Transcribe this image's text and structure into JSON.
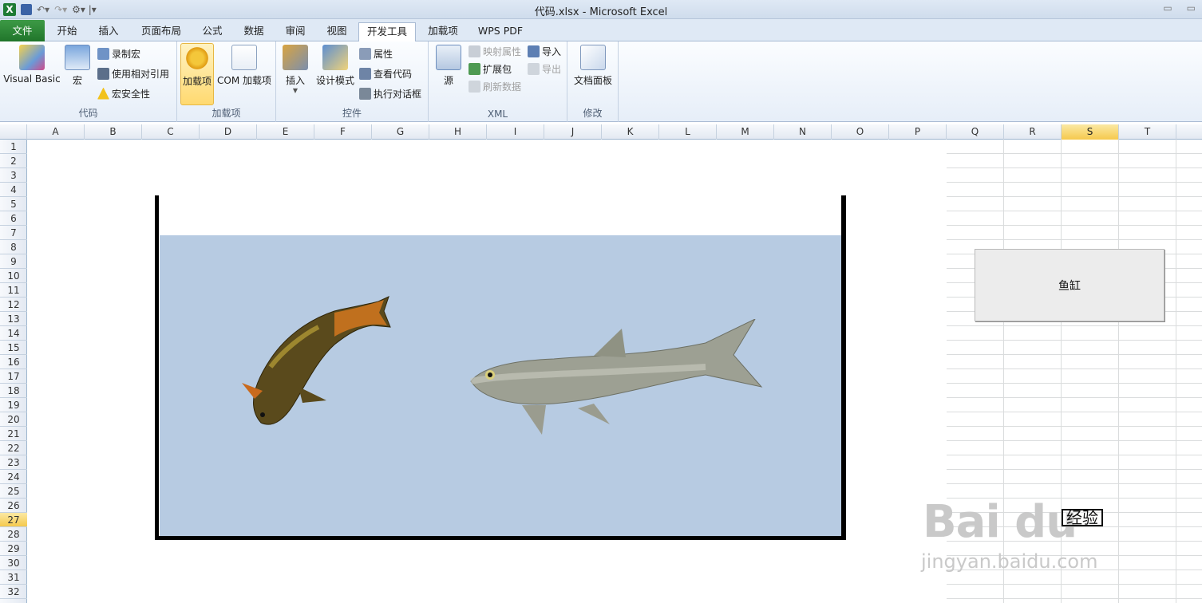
{
  "window": {
    "title": "代码.xlsx  -  Microsoft Excel",
    "excel_icon": "X"
  },
  "qat": {
    "icons": [
      "save-icon",
      "undo-icon",
      "redo-icon",
      "customize-icon"
    ]
  },
  "tabs": {
    "file": "文件",
    "items": [
      "开始",
      "插入",
      "页面布局",
      "公式",
      "数据",
      "审阅",
      "视图",
      "开发工具",
      "加载项",
      "WPS PDF"
    ],
    "active": "开发工具"
  },
  "ribbon": {
    "code": {
      "label": "代码",
      "visual_basic": "Visual Basic",
      "macro": "宏",
      "record_macro": "录制宏",
      "relative_ref": "使用相对引用",
      "macro_security": "宏安全性"
    },
    "addins": {
      "label": "加载项",
      "addins": "加载项",
      "com_addins": "COM 加载项"
    },
    "controls": {
      "label": "控件",
      "insert": "插入",
      "design_mode": "设计模式",
      "properties": "属性",
      "view_code": "查看代码",
      "run_dialog": "执行对话框"
    },
    "xml": {
      "label": "XML",
      "source": "源",
      "map_properties": "映射属性",
      "expansion_packs": "扩展包",
      "refresh_data": "刷新数据",
      "import": "导入",
      "export": "导出"
    },
    "modify": {
      "label": "修改",
      "doc_panel": "文档面板"
    }
  },
  "sheet": {
    "columns": [
      "A",
      "B",
      "C",
      "D",
      "E",
      "F",
      "G",
      "H",
      "I",
      "J",
      "K",
      "L",
      "M",
      "N",
      "O",
      "P",
      "Q",
      "R",
      "S",
      "T"
    ],
    "selected_column": "S",
    "rows": [
      "1",
      "2",
      "3",
      "4",
      "5",
      "6",
      "7",
      "8",
      "9",
      "10",
      "11",
      "12",
      "13",
      "14",
      "15",
      "16",
      "17",
      "18",
      "19",
      "20",
      "21",
      "22",
      "23",
      "24",
      "25",
      "26",
      "27",
      "28",
      "29",
      "30",
      "31",
      "32"
    ],
    "selected_row": "27"
  },
  "fish_button": {
    "label": "鱼缸"
  },
  "watermark": {
    "logo": "Bai du",
    "sub": "jingyan.baidu.com",
    "badge": "经验"
  },
  "colors": {
    "water": "#b7cbe2",
    "accent": "#f5c94d",
    "file_tab": "#2c8a38"
  }
}
